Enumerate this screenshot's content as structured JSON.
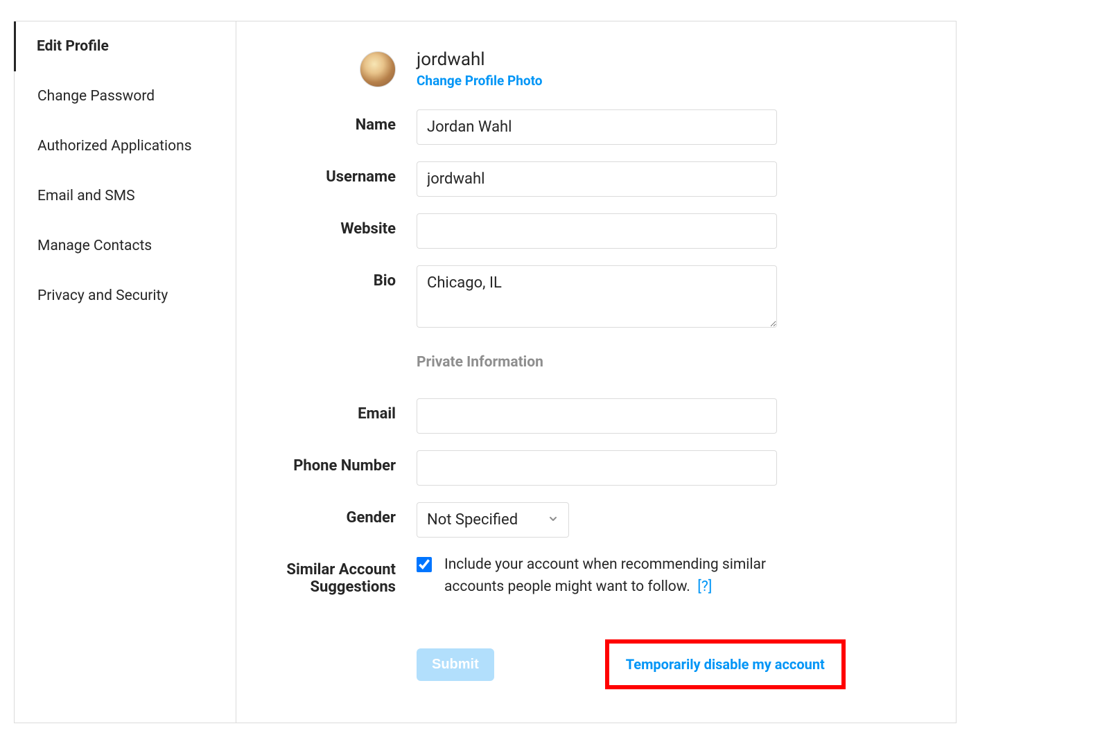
{
  "sidebar": {
    "items": [
      {
        "label": "Edit Profile",
        "active": true
      },
      {
        "label": "Change Password",
        "active": false
      },
      {
        "label": "Authorized Applications",
        "active": false
      },
      {
        "label": "Email and SMS",
        "active": false
      },
      {
        "label": "Manage Contacts",
        "active": false
      },
      {
        "label": "Privacy and Security",
        "active": false
      }
    ]
  },
  "profile": {
    "username": "jordwahl",
    "change_photo_label": "Change Profile Photo"
  },
  "labels": {
    "name": "Name",
    "username": "Username",
    "website": "Website",
    "bio": "Bio",
    "private_info": "Private Information",
    "email": "Email",
    "phone": "Phone Number",
    "gender": "Gender",
    "similar1": "Similar Account",
    "similar2": "Suggestions"
  },
  "fields": {
    "name": "Jordan Wahl",
    "username": "jordwahl",
    "website": "",
    "bio": "Chicago, IL",
    "email": "",
    "phone": "",
    "gender": "Not Specified"
  },
  "similar": {
    "text": "Include your account when recommending similar accounts people might want to follow.",
    "help": "[?]",
    "checked": true
  },
  "actions": {
    "submit": "Submit",
    "disable": "Temporarily disable my account"
  },
  "colors": {
    "link": "#0095f6",
    "border": "#dbdbdb",
    "muted": "#8e8e8e",
    "highlight": "#ff0000"
  }
}
